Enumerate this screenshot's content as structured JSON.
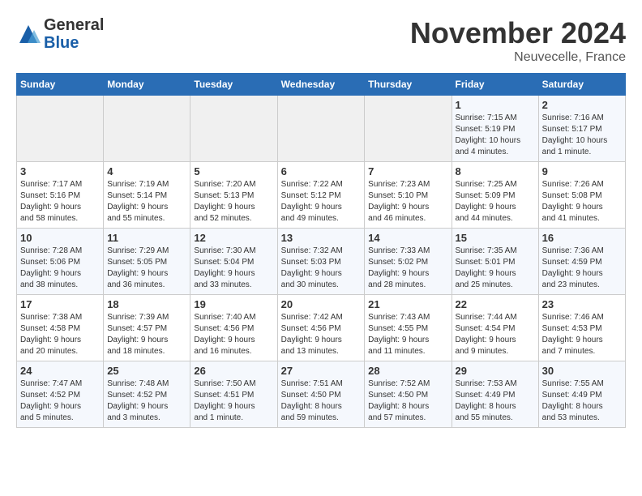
{
  "header": {
    "logo_line1": "General",
    "logo_line2": "Blue",
    "month_title": "November 2024",
    "location": "Neuvecelle, France"
  },
  "days_of_week": [
    "Sunday",
    "Monday",
    "Tuesday",
    "Wednesday",
    "Thursday",
    "Friday",
    "Saturday"
  ],
  "weeks": [
    [
      {
        "day": "",
        "info": ""
      },
      {
        "day": "",
        "info": ""
      },
      {
        "day": "",
        "info": ""
      },
      {
        "day": "",
        "info": ""
      },
      {
        "day": "",
        "info": ""
      },
      {
        "day": "1",
        "info": "Sunrise: 7:15 AM\nSunset: 5:19 PM\nDaylight: 10 hours\nand 4 minutes."
      },
      {
        "day": "2",
        "info": "Sunrise: 7:16 AM\nSunset: 5:17 PM\nDaylight: 10 hours\nand 1 minute."
      }
    ],
    [
      {
        "day": "3",
        "info": "Sunrise: 7:17 AM\nSunset: 5:16 PM\nDaylight: 9 hours\nand 58 minutes."
      },
      {
        "day": "4",
        "info": "Sunrise: 7:19 AM\nSunset: 5:14 PM\nDaylight: 9 hours\nand 55 minutes."
      },
      {
        "day": "5",
        "info": "Sunrise: 7:20 AM\nSunset: 5:13 PM\nDaylight: 9 hours\nand 52 minutes."
      },
      {
        "day": "6",
        "info": "Sunrise: 7:22 AM\nSunset: 5:12 PM\nDaylight: 9 hours\nand 49 minutes."
      },
      {
        "day": "7",
        "info": "Sunrise: 7:23 AM\nSunset: 5:10 PM\nDaylight: 9 hours\nand 46 minutes."
      },
      {
        "day": "8",
        "info": "Sunrise: 7:25 AM\nSunset: 5:09 PM\nDaylight: 9 hours\nand 44 minutes."
      },
      {
        "day": "9",
        "info": "Sunrise: 7:26 AM\nSunset: 5:08 PM\nDaylight: 9 hours\nand 41 minutes."
      }
    ],
    [
      {
        "day": "10",
        "info": "Sunrise: 7:28 AM\nSunset: 5:06 PM\nDaylight: 9 hours\nand 38 minutes."
      },
      {
        "day": "11",
        "info": "Sunrise: 7:29 AM\nSunset: 5:05 PM\nDaylight: 9 hours\nand 36 minutes."
      },
      {
        "day": "12",
        "info": "Sunrise: 7:30 AM\nSunset: 5:04 PM\nDaylight: 9 hours\nand 33 minutes."
      },
      {
        "day": "13",
        "info": "Sunrise: 7:32 AM\nSunset: 5:03 PM\nDaylight: 9 hours\nand 30 minutes."
      },
      {
        "day": "14",
        "info": "Sunrise: 7:33 AM\nSunset: 5:02 PM\nDaylight: 9 hours\nand 28 minutes."
      },
      {
        "day": "15",
        "info": "Sunrise: 7:35 AM\nSunset: 5:01 PM\nDaylight: 9 hours\nand 25 minutes."
      },
      {
        "day": "16",
        "info": "Sunrise: 7:36 AM\nSunset: 4:59 PM\nDaylight: 9 hours\nand 23 minutes."
      }
    ],
    [
      {
        "day": "17",
        "info": "Sunrise: 7:38 AM\nSunset: 4:58 PM\nDaylight: 9 hours\nand 20 minutes."
      },
      {
        "day": "18",
        "info": "Sunrise: 7:39 AM\nSunset: 4:57 PM\nDaylight: 9 hours\nand 18 minutes."
      },
      {
        "day": "19",
        "info": "Sunrise: 7:40 AM\nSunset: 4:56 PM\nDaylight: 9 hours\nand 16 minutes."
      },
      {
        "day": "20",
        "info": "Sunrise: 7:42 AM\nSunset: 4:56 PM\nDaylight: 9 hours\nand 13 minutes."
      },
      {
        "day": "21",
        "info": "Sunrise: 7:43 AM\nSunset: 4:55 PM\nDaylight: 9 hours\nand 11 minutes."
      },
      {
        "day": "22",
        "info": "Sunrise: 7:44 AM\nSunset: 4:54 PM\nDaylight: 9 hours\nand 9 minutes."
      },
      {
        "day": "23",
        "info": "Sunrise: 7:46 AM\nSunset: 4:53 PM\nDaylight: 9 hours\nand 7 minutes."
      }
    ],
    [
      {
        "day": "24",
        "info": "Sunrise: 7:47 AM\nSunset: 4:52 PM\nDaylight: 9 hours\nand 5 minutes."
      },
      {
        "day": "25",
        "info": "Sunrise: 7:48 AM\nSunset: 4:52 PM\nDaylight: 9 hours\nand 3 minutes."
      },
      {
        "day": "26",
        "info": "Sunrise: 7:50 AM\nSunset: 4:51 PM\nDaylight: 9 hours\nand 1 minute."
      },
      {
        "day": "27",
        "info": "Sunrise: 7:51 AM\nSunset: 4:50 PM\nDaylight: 8 hours\nand 59 minutes."
      },
      {
        "day": "28",
        "info": "Sunrise: 7:52 AM\nSunset: 4:50 PM\nDaylight: 8 hours\nand 57 minutes."
      },
      {
        "day": "29",
        "info": "Sunrise: 7:53 AM\nSunset: 4:49 PM\nDaylight: 8 hours\nand 55 minutes."
      },
      {
        "day": "30",
        "info": "Sunrise: 7:55 AM\nSunset: 4:49 PM\nDaylight: 8 hours\nand 53 minutes."
      }
    ]
  ]
}
